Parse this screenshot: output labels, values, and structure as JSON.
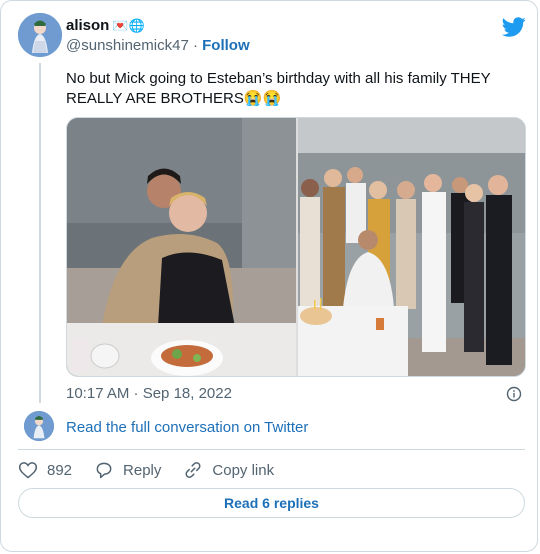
{
  "author": {
    "name": "alison",
    "name_emojis": "💌🌐",
    "handle": "@sunshinemick47",
    "separator": "·",
    "follow_label": "Follow"
  },
  "tweet": {
    "text": "No but Mick going to Esteban’s birthday with all his family THEY REALLY ARE BROTHERS😭😭",
    "timestamp": "10:17 AM · Sep 18, 2022",
    "media": [
      {
        "icon": "photo-two-men-restaurant"
      },
      {
        "icon": "photo-group-birthday-cake"
      }
    ]
  },
  "conversation": {
    "read_full_label": "Read the full conversation on Twitter"
  },
  "actions": {
    "like_count": "892",
    "reply_label": "Reply",
    "copy_link_label": "Copy link"
  },
  "replies_button": {
    "label": "Read 6 replies"
  },
  "colors": {
    "link": "#1d70b8",
    "twitter_blue": "#1d9bf0",
    "muted": "#536471",
    "border": "#cfd9de"
  }
}
